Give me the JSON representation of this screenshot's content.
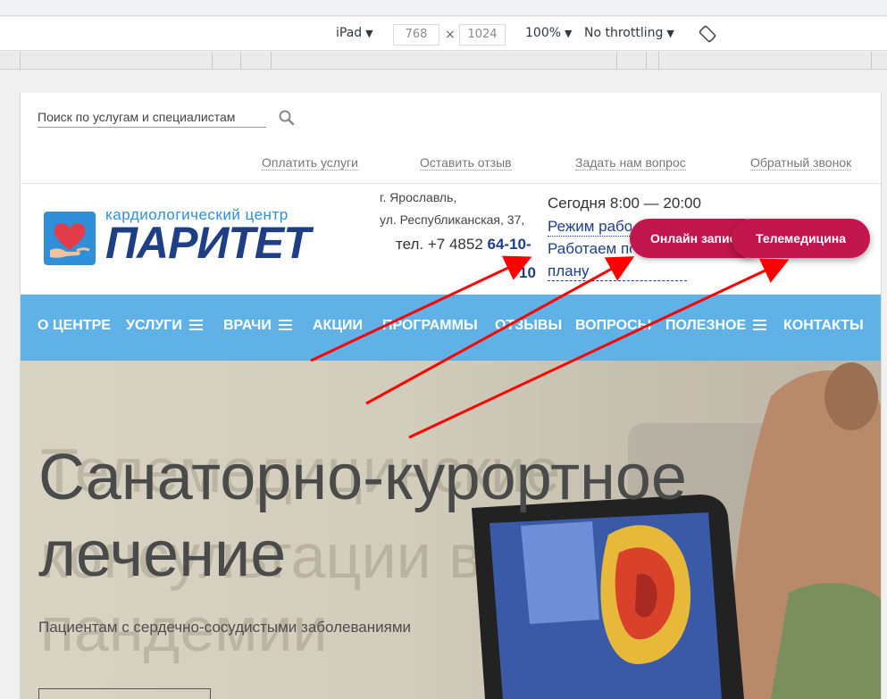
{
  "devtools": {
    "device": "iPad",
    "width": "768",
    "height": "1024",
    "times": "×",
    "zoom": "100%",
    "throttling": "No throttling",
    "caret": "▼"
  },
  "header": {
    "search_placeholder": "Поиск по услугам и специалистам",
    "top_links": [
      "Оплатить услуги",
      "Оставить отзыв",
      "Задать нам вопрос",
      "Обратный звонок"
    ],
    "logo_subtitle": "кардиологический центр",
    "logo_title": "ПАРИТЕТ",
    "address_line1": "г. Ярославль,",
    "address_line2": "ул. Республиканская, 37,",
    "phone_prefix": "тел. +7 4852 ",
    "phone_bold": "64-10-",
    "phone_tail": "10",
    "hours_today": "Сегодня 8:00 — 20:00",
    "hours_link": "Режим работы",
    "plan_line1": "Работаем по",
    "plan_line2": "плану",
    "btn_online": "Онлайн запись",
    "btn_tele": "Телемедицина"
  },
  "nav": {
    "items": [
      "О ЦЕНТРЕ",
      "УСЛУГИ",
      "ВРАЧИ",
      "АКЦИИ",
      "ПРОГРАММЫ",
      "ОТЗЫВЫ",
      "ВОПРОСЫ",
      "ПОЛЕЗНОЕ",
      "КОНТАКТЫ"
    ]
  },
  "hero": {
    "ghost_line1": "Телемедицинские",
    "ghost_line2": "консультации в период",
    "ghost_line3": "пандемии",
    "title_line1": "Санаторно-курортное",
    "title_line2": "лечение",
    "subtitle": "Пациентам с сердечно-сосудистыми заболеваниями"
  },
  "colors": {
    "nav_bg": "#5fb1e6",
    "brand_dark": "#1e3e86",
    "accent_button": "#c2174e",
    "annotation_arrow": "#ff0000"
  }
}
